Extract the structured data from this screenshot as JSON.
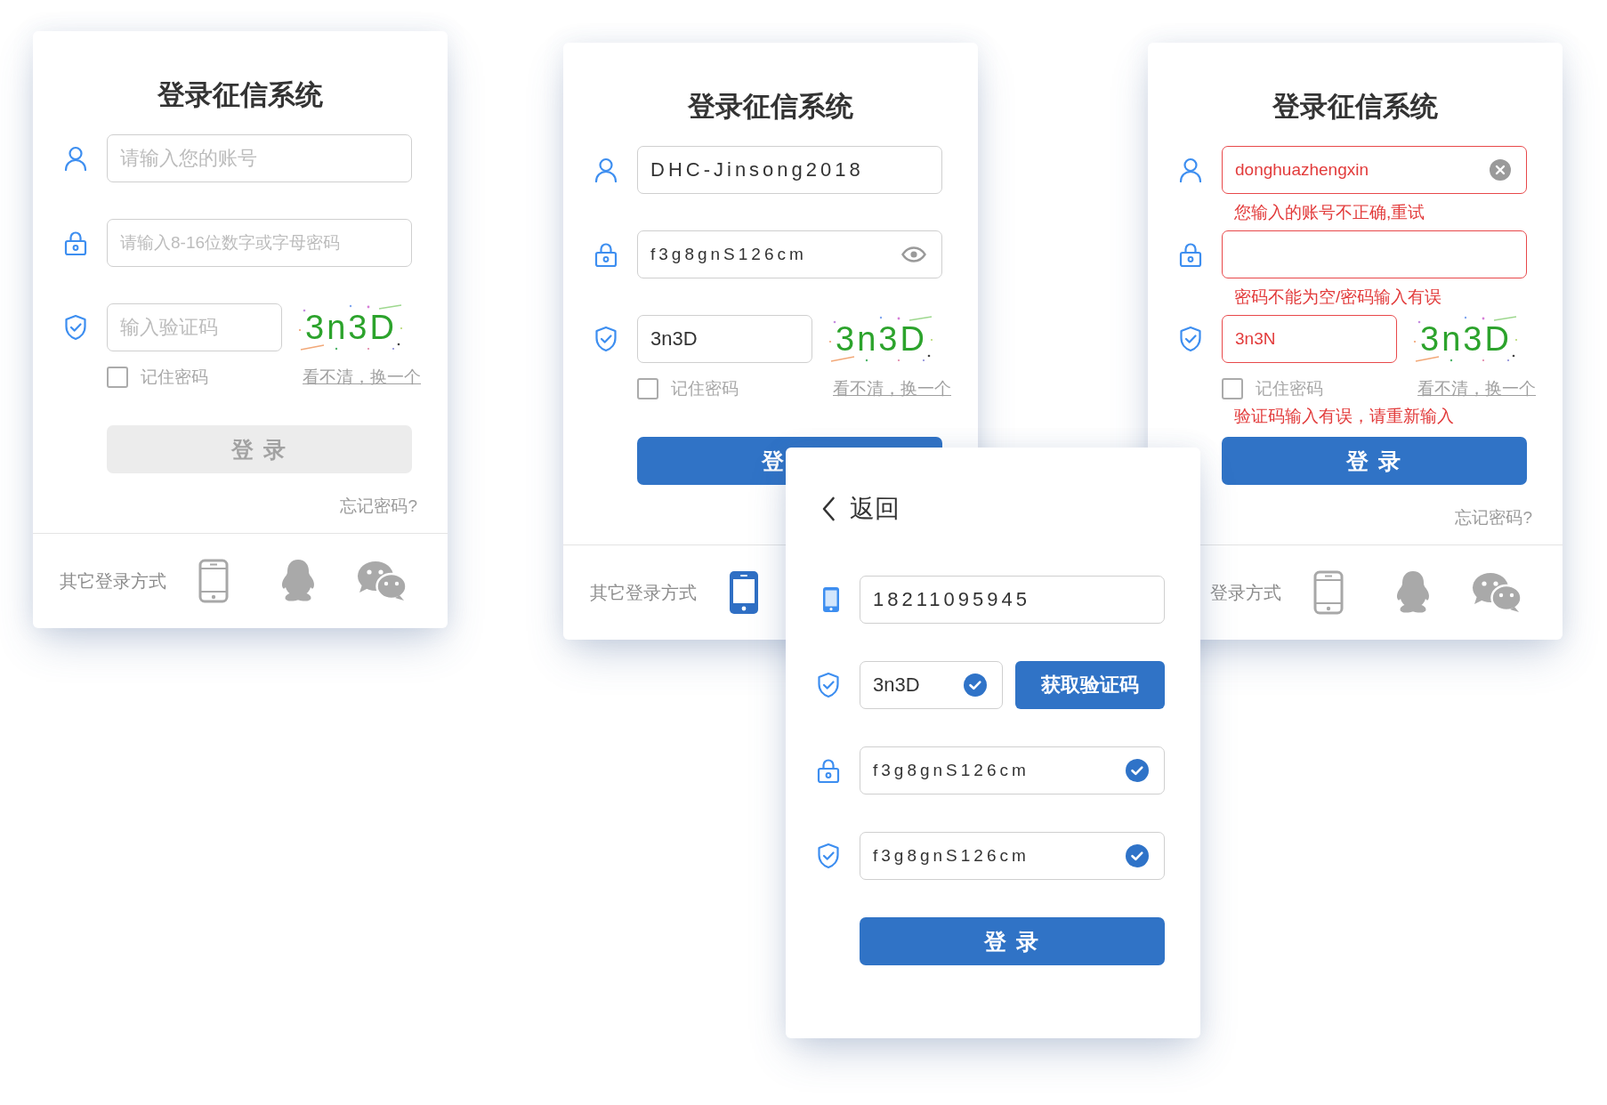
{
  "cards": [
    {
      "kind": "account_login",
      "title": "登录征信系统",
      "fields": [
        {
          "kind": "account",
          "placeholder": "请输入您的账号",
          "error": false
        },
        {
          "kind": "password",
          "placeholder": "请输入8-16位数字或字母密码",
          "error": false
        },
        {
          "kind": "captcha",
          "placeholder": "输入验证码",
          "error": false,
          "captcha_text": "3n3D"
        }
      ],
      "remember": {
        "label": "记住密码",
        "checked": false
      },
      "refresh_link": "看不清，换一个",
      "submit": {
        "label": "登 录",
        "disabled": true
      },
      "forgot_link": "忘记密码?",
      "other_login": {
        "label": "其它登录方式",
        "methods": [
          {
            "kind": "phone",
            "selected": false
          },
          {
            "kind": "qq",
            "selected": false
          },
          {
            "kind": "wechat",
            "selected": false
          }
        ]
      }
    },
    {
      "kind": "account_login",
      "title": "登录征信系统",
      "fields": [
        {
          "kind": "account",
          "value": "DHC-Jinsong2018",
          "error": false
        },
        {
          "kind": "password",
          "value": "f3g8gnS126cm",
          "error": false,
          "suffix": {
            "kind": "eye"
          }
        },
        {
          "kind": "captcha",
          "value": "3n3D",
          "error": false,
          "captcha_text": "3n3D"
        }
      ],
      "remember": {
        "label": "记住密码",
        "checked": false
      },
      "refresh_link": "看不清，换一个",
      "submit": {
        "label": "登",
        "disabled": false
      },
      "other_login": {
        "label": "其它登录方式",
        "methods": [
          {
            "kind": "phone",
            "selected": true
          }
        ]
      }
    },
    {
      "kind": "account_login",
      "title": "登录征信系统",
      "fields": [
        {
          "kind": "account",
          "value": "donghuazhengxin",
          "error": true,
          "suffix": {
            "kind": "clear"
          },
          "error_message": "您输入的账号不正确,重试"
        },
        {
          "kind": "password",
          "error": true,
          "error_message": "密码不能为空/密码输入有误"
        },
        {
          "kind": "captcha",
          "value": "3n3N",
          "error": true,
          "captcha_text": "3n3D",
          "error_message": "验证码输入有误，请重新输入"
        }
      ],
      "remember": {
        "label": "记住密码",
        "checked": false
      },
      "refresh_link": "看不清，换一个",
      "submit": {
        "label": "登 录",
        "disabled": false
      },
      "forgot_link": "忘记密码?",
      "other_login": {
        "label": "登录方式",
        "methods": [
          {
            "kind": "phone",
            "selected": false
          },
          {
            "kind": "qq",
            "selected": false
          },
          {
            "kind": "wechat",
            "selected": false
          }
        ]
      }
    },
    {
      "kind": "phone_login",
      "back": {
        "label": "返回"
      },
      "fields": [
        {
          "kind": "phone",
          "value": "18211095945",
          "valid": false
        },
        {
          "kind": "code",
          "value": "3n3D",
          "valid": true,
          "button": "获取验证码"
        },
        {
          "kind": "password",
          "value": "f3g8gnS126cm",
          "valid": true
        },
        {
          "kind": "confirm",
          "value": "f3g8gnS126cm",
          "valid": true
        }
      ],
      "submit": {
        "label": "登 录",
        "disabled": false
      }
    }
  ]
}
